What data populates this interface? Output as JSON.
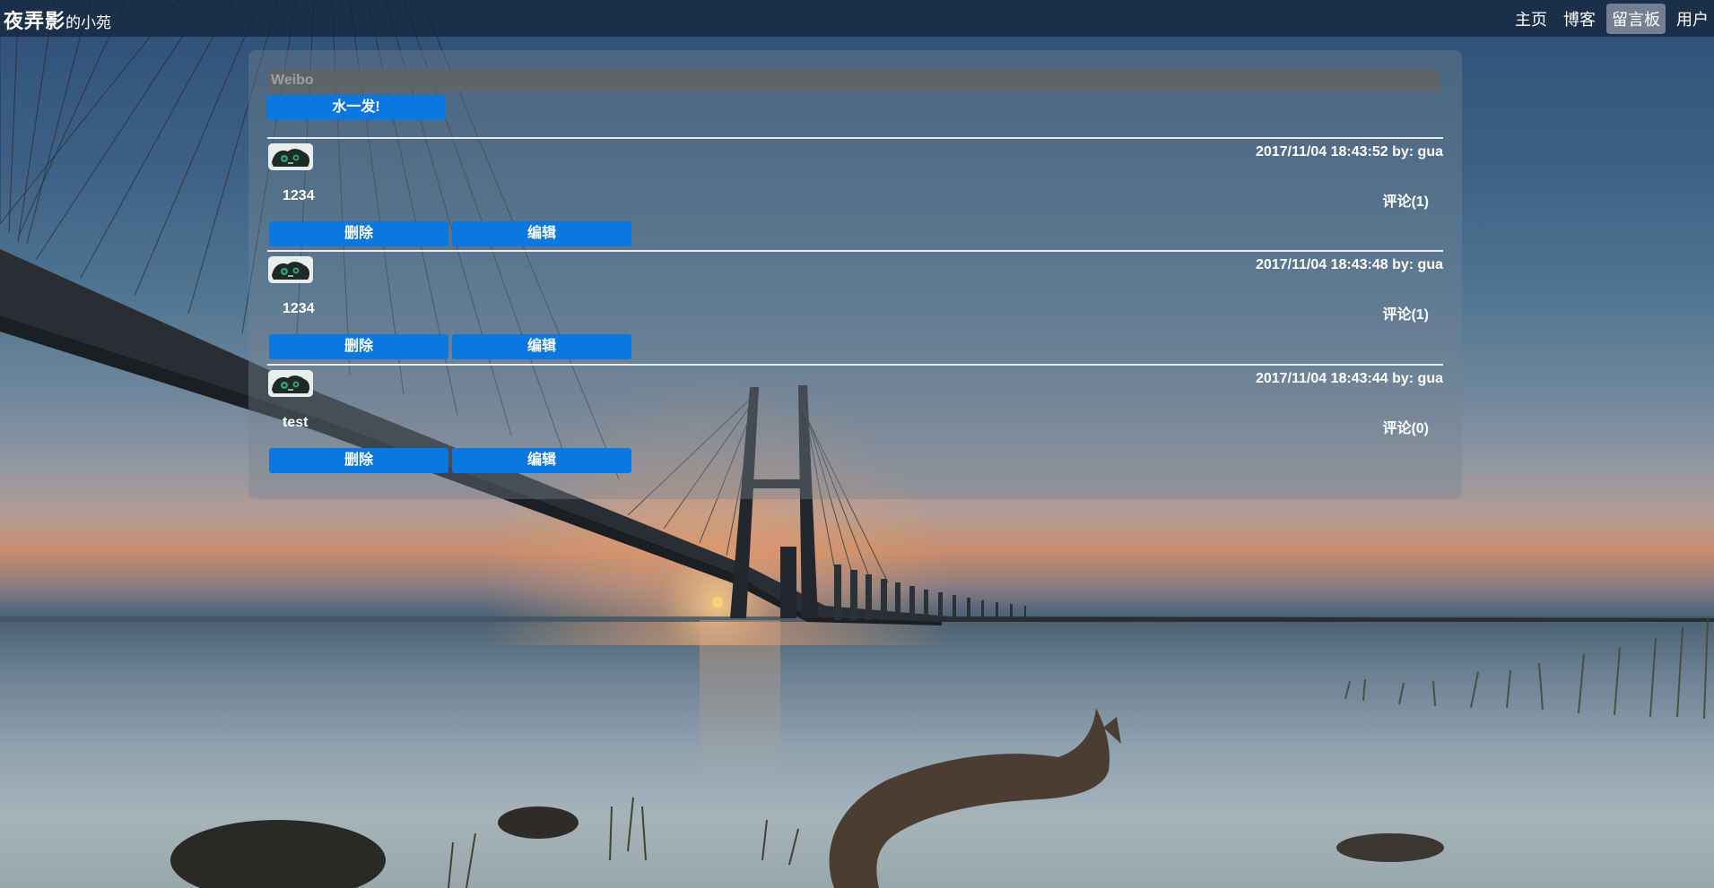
{
  "nav": {
    "brand_main": "夜弄影",
    "brand_sub": "的小苑",
    "links": [
      "主页",
      "博客",
      "留言板",
      "用户"
    ],
    "active_index": 2
  },
  "composer": {
    "placeholder": "Weibo",
    "submit_label": "水一发!"
  },
  "posts": [
    {
      "timestamp": "2017/11/04 18:43:52",
      "author_prefix": "by:",
      "author": "gua",
      "content": "1234",
      "comments_label": "评论(1)",
      "delete_label": "删除",
      "edit_label": "编辑"
    },
    {
      "timestamp": "2017/11/04 18:43:48",
      "author_prefix": "by:",
      "author": "gua",
      "content": "1234",
      "comments_label": "评论(1)",
      "delete_label": "删除",
      "edit_label": "编辑"
    },
    {
      "timestamp": "2017/11/04 18:43:44",
      "author_prefix": "by:",
      "author": "gua",
      "content": "test",
      "comments_label": "评论(0)",
      "delete_label": "删除",
      "edit_label": "编辑"
    }
  ],
  "colors": {
    "accent": "#0b78e0",
    "nav_bg": "#142438"
  }
}
